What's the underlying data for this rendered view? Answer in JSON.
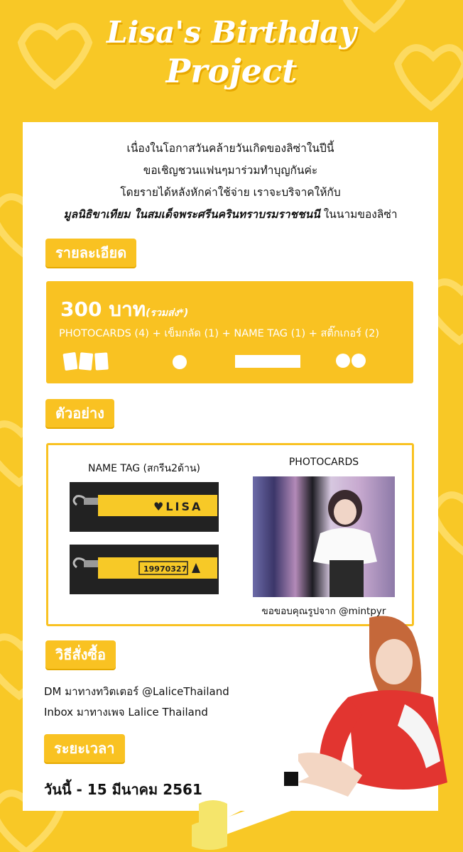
{
  "title": {
    "line1": "Lisa's Birthday",
    "line2": "Project"
  },
  "intro": {
    "line1": "เนื่องในโอกาสวันคล้ายวันเกิดของลิซ่าในปีนี้",
    "line2": "ขอเชิญชวนแฟนๆมาร่วมทำบุญกันค่ะ",
    "line3": "โดยรายได้หลังหักค่าใช้จ่าย เราจะบริจาคให้กับ",
    "line4_bold": "มูลนิธิขาเทียม ในสมเด็จพระศรีนครินทราบรมราชชนนี",
    "line4_rest": " ในนามของลิซ่า"
  },
  "details": {
    "tag": "รายละเอียด",
    "price": "300 บาท",
    "price_note": "(รวมส่ง*)",
    "items": "PHOTOCARDS (4) + เข็มกลัด (1) + NAME TAG (1) + สติ๊กเกอร์ (2)"
  },
  "samples": {
    "tag": "ตัวอย่าง",
    "nametag_title": "NAME TAG (สกรีน2ด้าน)",
    "nametag_front": "♥LISA",
    "nametag_back": "19970327",
    "photocards_title": "PHOTOCARDS",
    "credit": "ขอขอบคุณรูปจาก @mintpyr"
  },
  "order": {
    "tag": "วิธีสั่งซื้อ",
    "line1": "DM มาทางทวิตเตอร์ @LaliceThailand",
    "line2": "Inbox มาทางเพจ Lalice Thailand"
  },
  "period": {
    "tag": "ระยะเวลา",
    "date": "วันนี้ - 15 มีนาคม 2561"
  },
  "colors": {
    "accent": "#f9c222",
    "background": "#f8c826",
    "card": "#ffffff"
  }
}
